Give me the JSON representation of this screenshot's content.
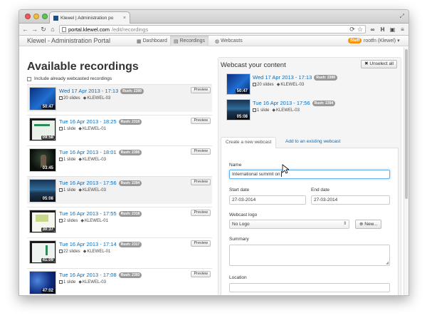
{
  "browser": {
    "tab_title": "Klewel | Administration po",
    "tab_close": "×",
    "url_host": "portal.klewel.com",
    "url_path": "/edit/recordings",
    "traffic_colors": [
      "#ee5b52",
      "#f6bc3e",
      "#5fc453"
    ]
  },
  "navbar": {
    "brand": "Klewel - Administration Portal",
    "items": [
      {
        "label": "Dashboard",
        "icon": "grid-icon"
      },
      {
        "label": "Recordings",
        "icon": "film-icon"
      },
      {
        "label": "Webcasts",
        "icon": "globe-icon"
      }
    ],
    "staff_badge": "Staff",
    "user": "rootfn (Klewel) ▾"
  },
  "left": {
    "title": "Available recordings",
    "include_label": "Include already webcasted recordings",
    "preview_label": "Preview",
    "recordings": [
      {
        "date": "Wed 17 Apr 2013 - 17:13",
        "badge": "Rush: 2399",
        "slides": "20 slides",
        "tag": "KLEWEL-03",
        "duration": "50:47",
        "selected": true
      },
      {
        "date": "Tue 16 Apr 2013 - 18:25",
        "badge": "Rush: 2319",
        "slides": "1 slide",
        "tag": "KLEWEL-01",
        "duration": "09:58",
        "selected": false
      },
      {
        "date": "Tue 16 Apr 2013 - 18:01",
        "badge": "Rush: 2395",
        "slides": "1 slide",
        "tag": "KLEWEL-03",
        "duration": "03:45",
        "selected": false
      },
      {
        "date": "Tue 16 Apr 2013 - 17:56",
        "badge": "Rush: 2394",
        "slides": "1 slide",
        "tag": "KLEWEL-03",
        "duration": "05:08",
        "selected": true
      },
      {
        "date": "Tue 16 Apr 2013 - 17:55",
        "badge": "Rush: 2318",
        "slides": "2 slides",
        "tag": "KLEWEL-01",
        "duration": "30:37",
        "selected": false
      },
      {
        "date": "Tue 16 Apr 2013 - 17:14",
        "badge": "Rush: 2317",
        "slides": "22 slides",
        "tag": "KLEWEL-01",
        "duration": "41:09",
        "selected": false
      },
      {
        "date": "Tue 16 Apr 2013 - 17:08",
        "badge": "Rush: 2393",
        "slides": "1 slide",
        "tag": "KLEWEL-03",
        "duration": "47:02",
        "selected": false
      }
    ]
  },
  "right": {
    "title": "Webcast your content",
    "unselect_label": "✖ Unselect all",
    "selected": [
      {
        "date": "Wed 17 Apr 2013 - 17:13",
        "badge": "Rush: 2399",
        "slides": "20 slides",
        "tag": "KLEWEL-03",
        "duration": "50:47"
      },
      {
        "date": "Tue 16 Apr 2013 - 17:56",
        "badge": "Rush: 2394",
        "slides": "1 slide",
        "tag": "KLEWEL-03",
        "duration": "05:08"
      }
    ],
    "tabs": {
      "create": "Create a new webcast",
      "add": "Add to an existing webcast"
    },
    "form": {
      "name_label": "Name",
      "name_value": "International summit on",
      "start_label": "Start date",
      "start_value": "27-03-2014",
      "end_label": "End date",
      "end_value": "27-03-2014",
      "logo_label": "Webcast logo",
      "logo_value": "No Logo",
      "new_label": "⊕ New...",
      "summary_label": "Summary",
      "location_label": "Location"
    }
  }
}
